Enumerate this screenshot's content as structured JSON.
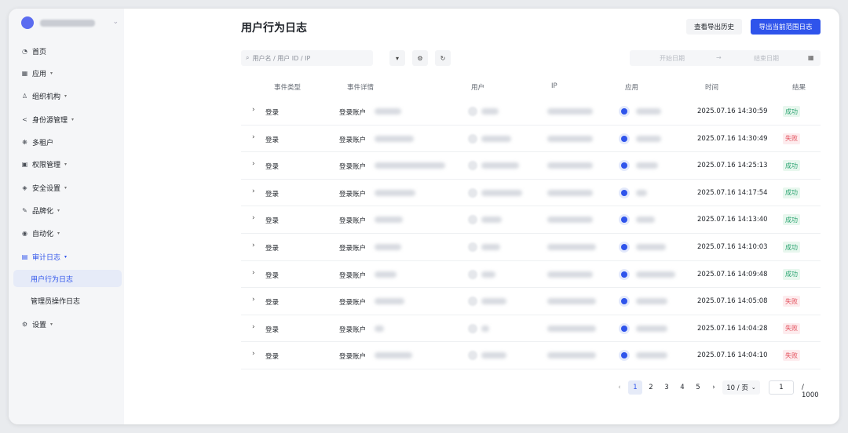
{
  "sidebar": {
    "items": [
      {
        "label": "首页",
        "icon": "pie-chart-icon",
        "has_caret": false
      },
      {
        "label": "应用",
        "icon": "grid-icon",
        "has_caret": true
      },
      {
        "label": "组织机构",
        "icon": "org-icon",
        "has_caret": true
      },
      {
        "label": "身份源管理",
        "icon": "share-icon",
        "has_caret": true
      },
      {
        "label": "多租户",
        "icon": "tenant-icon",
        "has_caret": false
      },
      {
        "label": "权限管理",
        "icon": "lock-icon",
        "has_caret": true
      },
      {
        "label": "安全设置",
        "icon": "shield-icon",
        "has_caret": true
      },
      {
        "label": "品牌化",
        "icon": "brush-icon",
        "has_caret": true
      },
      {
        "label": "自动化",
        "icon": "robot-icon",
        "has_caret": true
      },
      {
        "label": "审计日志",
        "icon": "audit-icon",
        "has_caret": true,
        "active": true
      },
      {
        "label": "设置",
        "icon": "gear-icon",
        "has_caret": true
      }
    ],
    "audit_sub": [
      {
        "label": "用户行为日志",
        "active": true
      },
      {
        "label": "管理员操作日志",
        "active": false
      }
    ]
  },
  "header": {
    "title": "用户行为日志",
    "history_button": "查看导出历史",
    "export_button": "导出当前范围日志"
  },
  "toolbar": {
    "search_placeholder": "用户名 / 用户 ID / IP",
    "start_date_placeholder": "开始日期",
    "end_date_placeholder": "结束日期",
    "arrow": "→"
  },
  "table": {
    "columns": [
      "事件类型",
      "事件详情",
      "用户",
      "IP",
      "应用",
      "时间",
      "结果"
    ],
    "rows": [
      {
        "type": "登录",
        "detail": "登录账户",
        "time": "2025.07.16 14:30:59",
        "result": "成功",
        "status": "ok"
      },
      {
        "type": "登录",
        "detail": "登录账户",
        "time": "2025.07.16 14:30:49",
        "result": "失败",
        "status": "fail"
      },
      {
        "type": "登录",
        "detail": "登录账户",
        "time": "2025.07.16 14:25:13",
        "result": "成功",
        "status": "ok"
      },
      {
        "type": "登录",
        "detail": "登录账户",
        "time": "2025.07.16 14:17:54",
        "result": "成功",
        "status": "ok"
      },
      {
        "type": "登录",
        "detail": "登录账户",
        "time": "2025.07.16 14:13:40",
        "result": "成功",
        "status": "ok"
      },
      {
        "type": "登录",
        "detail": "登录账户",
        "time": "2025.07.16 14:10:03",
        "result": "成功",
        "status": "ok"
      },
      {
        "type": "登录",
        "detail": "登录账户",
        "time": "2025.07.16 14:09:48",
        "result": "成功",
        "status": "ok"
      },
      {
        "type": "登录",
        "detail": "登录账户",
        "time": "2025.07.16 14:05:08",
        "result": "失败",
        "status": "fail"
      },
      {
        "type": "登录",
        "detail": "登录账户",
        "time": "2025.07.16 14:04:28",
        "result": "失败",
        "status": "fail"
      },
      {
        "type": "登录",
        "detail": "登录账户",
        "time": "2025.07.16 14:04:10",
        "result": "失败",
        "status": "fail"
      }
    ]
  },
  "pagination": {
    "prev": "‹",
    "next": "›",
    "pages": [
      "1",
      "2",
      "3",
      "4",
      "5"
    ],
    "current": "1",
    "page_size": "10 / 页",
    "jump_value": "1",
    "total": "/ 1000"
  },
  "colors": {
    "accent": "#2f54eb",
    "success": "#2ba471",
    "fail": "#e34d59"
  }
}
